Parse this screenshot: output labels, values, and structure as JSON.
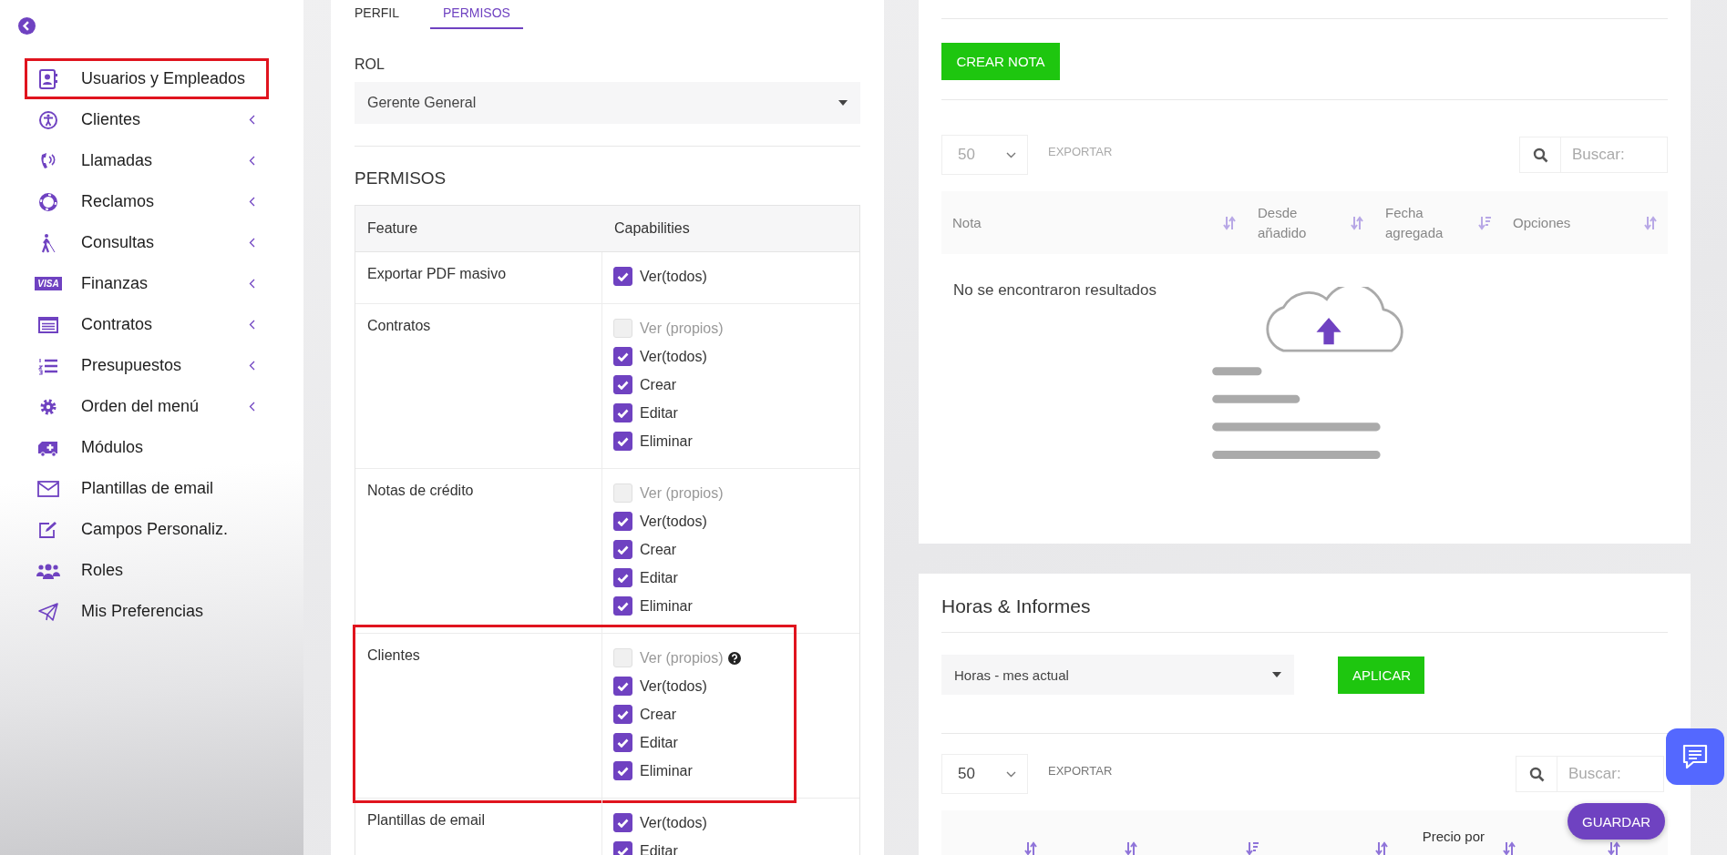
{
  "sidebar": {
    "items": [
      {
        "label": "Usuarios y Empleados",
        "submenu": false,
        "highlighted": true
      },
      {
        "label": "Clientes",
        "submenu": true,
        "highlighted": false
      },
      {
        "label": "Llamadas",
        "submenu": true,
        "highlighted": false
      },
      {
        "label": "Reclamos",
        "submenu": true,
        "highlighted": false
      },
      {
        "label": "Consultas",
        "submenu": true,
        "highlighted": false
      },
      {
        "label": "Finanzas",
        "submenu": true,
        "highlighted": false,
        "icon_text": "VISA"
      },
      {
        "label": "Contratos",
        "submenu": true,
        "highlighted": false
      },
      {
        "label": "Presupuestos",
        "submenu": true,
        "highlighted": false
      },
      {
        "label": "Orden del menú",
        "submenu": true,
        "highlighted": false
      },
      {
        "label": "Módulos",
        "submenu": false,
        "highlighted": false
      },
      {
        "label": "Plantillas de email",
        "submenu": false,
        "highlighted": false
      },
      {
        "label": "Campos Personaliz.",
        "submenu": false,
        "highlighted": false
      },
      {
        "label": "Roles",
        "submenu": false,
        "highlighted": false
      },
      {
        "label": "Mis Preferencias",
        "submenu": false,
        "highlighted": false
      }
    ]
  },
  "profile_card": {
    "tabs": [
      {
        "label": "PERFIL",
        "selected": false
      },
      {
        "label": "PERMISOS",
        "selected": true
      }
    ],
    "role_label": "ROL",
    "role_value": "Gerente General",
    "permissions_title": "PERMISOS",
    "table": {
      "columns": [
        "Feature",
        "Capabilities"
      ],
      "rows": [
        {
          "feature": "Exportar PDF masivo",
          "highlighted": false,
          "capabilities": [
            {
              "label": "Ver(todos)",
              "checked": true,
              "disabled": false,
              "help": false
            }
          ]
        },
        {
          "feature": "Contratos",
          "highlighted": false,
          "capabilities": [
            {
              "label": "Ver (propios)",
              "checked": false,
              "disabled": true,
              "help": false
            },
            {
              "label": "Ver(todos)",
              "checked": true,
              "disabled": false,
              "help": false
            },
            {
              "label": "Crear",
              "checked": true,
              "disabled": false,
              "help": false
            },
            {
              "label": "Editar",
              "checked": true,
              "disabled": false,
              "help": false
            },
            {
              "label": "Eliminar",
              "checked": true,
              "disabled": false,
              "help": false
            }
          ]
        },
        {
          "feature": "Notas de crédito",
          "highlighted": false,
          "capabilities": [
            {
              "label": "Ver (propios)",
              "checked": false,
              "disabled": true,
              "help": false
            },
            {
              "label": "Ver(todos)",
              "checked": true,
              "disabled": false,
              "help": false
            },
            {
              "label": "Crear",
              "checked": true,
              "disabled": false,
              "help": false
            },
            {
              "label": "Editar",
              "checked": true,
              "disabled": false,
              "help": false
            },
            {
              "label": "Eliminar",
              "checked": true,
              "disabled": false,
              "help": false
            }
          ]
        },
        {
          "feature": "Clientes",
          "highlighted": true,
          "capabilities": [
            {
              "label": "Ver (propios)",
              "checked": false,
              "disabled": true,
              "help": true
            },
            {
              "label": "Ver(todos)",
              "checked": true,
              "disabled": false,
              "help": false
            },
            {
              "label": "Crear",
              "checked": true,
              "disabled": false,
              "help": false
            },
            {
              "label": "Editar",
              "checked": true,
              "disabled": false,
              "help": false
            },
            {
              "label": "Eliminar",
              "checked": true,
              "disabled": false,
              "help": false
            }
          ]
        },
        {
          "feature": "Plantillas de email",
          "highlighted": false,
          "capabilities": [
            {
              "label": "Ver(todos)",
              "checked": true,
              "disabled": false,
              "help": false
            },
            {
              "label": "Editar",
              "checked": true,
              "disabled": false,
              "help": false
            }
          ]
        }
      ]
    }
  },
  "notes_card": {
    "create_button": "CREAR NOTA",
    "page_size": "50",
    "export": "EXPORTAR",
    "search_placeholder": "Buscar:",
    "controls_disabled": true,
    "columns": [
      {
        "label": "Nota",
        "sorted": false
      },
      {
        "label": "Desde añadido",
        "sorted": false
      },
      {
        "label": "Fecha agregada",
        "sorted": true
      },
      {
        "label": "Opciones",
        "sorted": false
      }
    ],
    "empty_text": "No se encontraron resultados"
  },
  "hours_card": {
    "title": "Horas & Informes",
    "period": "Horas - mes actual",
    "apply_button": "APLICAR",
    "page_size": "50",
    "export": "EXPORTAR",
    "search_placeholder": "Buscar:",
    "controls_disabled": false,
    "columns": [
      {
        "sorted": false
      },
      {
        "sorted": false
      },
      {
        "sorted": true
      },
      {
        "sorted": false
      },
      {
        "label": "Precio por",
        "sorted": false
      },
      {
        "sorted": false
      }
    ]
  },
  "save_button": "GUARDAR"
}
